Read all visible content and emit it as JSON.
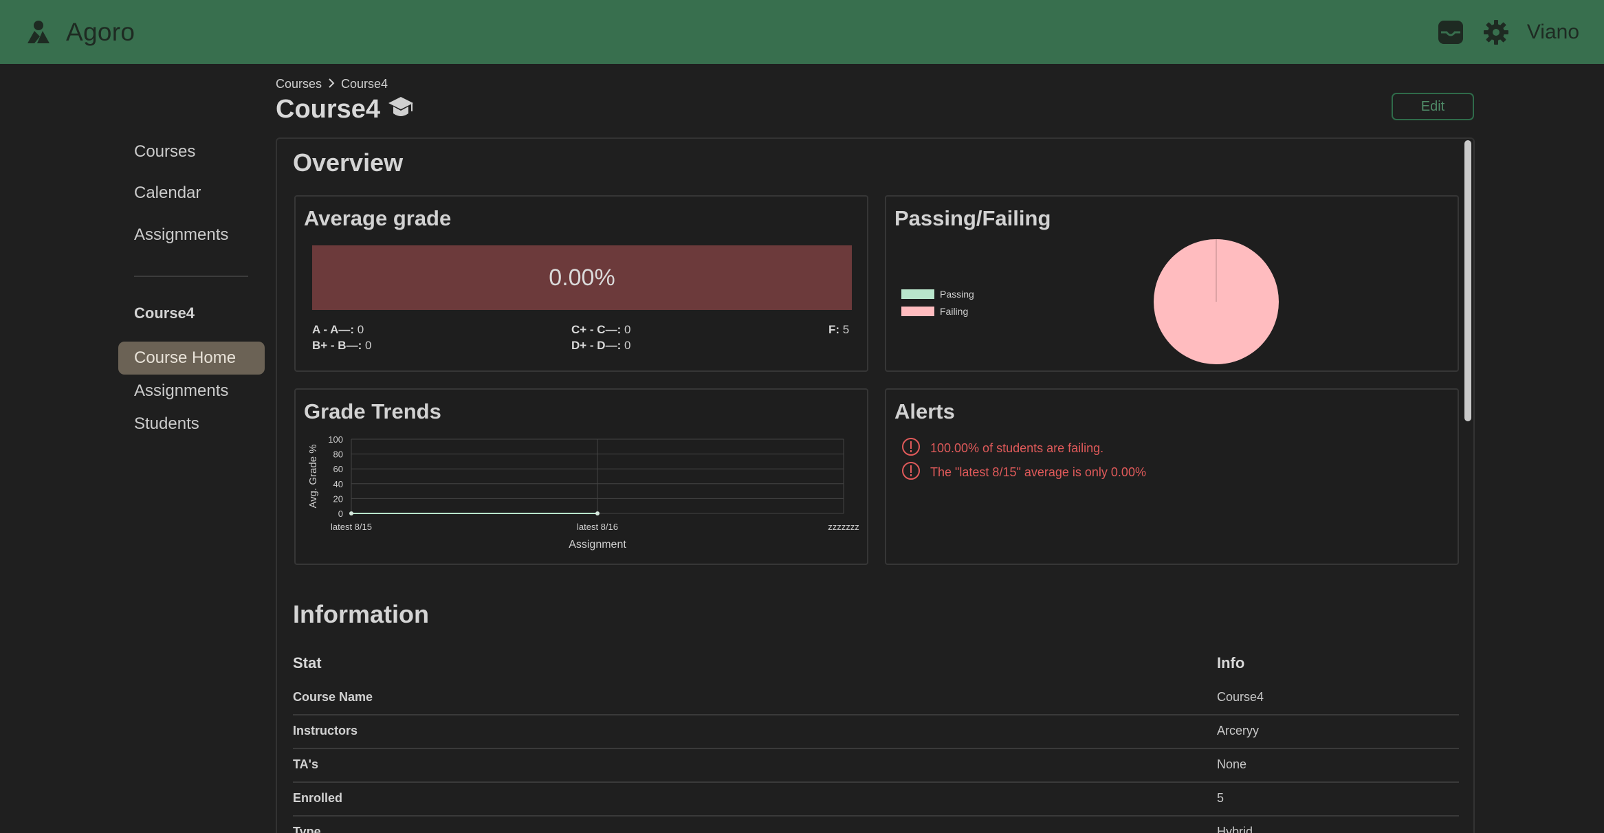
{
  "app": {
    "name": "Agoro",
    "user": "Viano",
    "colors": {
      "topbar": "#386f4e",
      "background": "#1f1f1f",
      "accent": "#2f6b4a",
      "alert": "#e05a5a"
    },
    "icons": [
      "agoro-logo-icon",
      "inbox-icon",
      "gear-icon"
    ]
  },
  "sidebar": {
    "main": [
      "Courses",
      "Calendar",
      "Assignments"
    ],
    "course_name": "Course4",
    "course_links": [
      "Course Home",
      "Assignments",
      "Students"
    ],
    "active": "Course Home"
  },
  "breadcrumb": [
    "Courses",
    "Course4"
  ],
  "page": {
    "title": "Course4",
    "title_icon": "graduation-cap-icon",
    "edit_label": "Edit"
  },
  "overview": {
    "title": "Overview",
    "average_grade": {
      "title": "Average grade",
      "value": "0.00%",
      "bar_color": "#6c3a3b",
      "dist": {
        "a_label": "A - A—:",
        "a_val": "0",
        "b_label": "B+ - B—:",
        "b_val": "0",
        "c_label": "C+ - C—:",
        "c_val": "0",
        "d_label": "D+ - D—:",
        "d_val": "0",
        "f_label": "F:",
        "f_val": "5"
      }
    },
    "passing_failing": {
      "title": "Passing/Failing",
      "legend": [
        {
          "label": "Passing",
          "color": "#b9e6cc"
        },
        {
          "label": "Failing",
          "color": "#ffbcbf"
        }
      ]
    },
    "grade_trends": {
      "title": "Grade Trends"
    },
    "alerts": {
      "title": "Alerts",
      "icon": "alert-circle-icon",
      "items": [
        "100.00% of students are failing.",
        "The \"latest 8/15\" average is only 0.00%"
      ]
    }
  },
  "chart_data": [
    {
      "type": "pie",
      "categories": [
        "Passing",
        "Failing"
      ],
      "values": [
        0,
        5
      ],
      "legend_position": "left"
    },
    {
      "type": "line",
      "categories": [
        "latest 8/15",
        "latest 8/16",
        "zzzzzzz"
      ],
      "values": [
        0,
        0,
        null
      ],
      "xlabel": "Assignment",
      "ylabel": "Avg. Grade %",
      "ylim": [
        0,
        100
      ],
      "yticks": [
        "100",
        "80",
        "60",
        "40",
        "20",
        "0"
      ],
      "grid": true
    }
  ],
  "information": {
    "title": "Information",
    "headers": {
      "stat": "Stat",
      "info": "Info"
    },
    "rows": [
      {
        "stat": "Course Name",
        "info": "Course4"
      },
      {
        "stat": "Instructors",
        "info": "Arceryy"
      },
      {
        "stat": "TA's",
        "info": "None"
      },
      {
        "stat": "Enrolled",
        "info": "5"
      },
      {
        "stat": "Type",
        "info": "Hybrid"
      }
    ]
  }
}
